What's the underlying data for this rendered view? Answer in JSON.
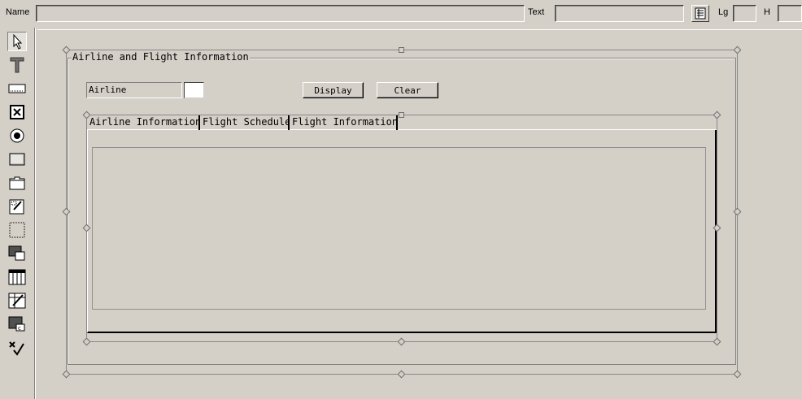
{
  "propbar": {
    "name_label": "Name",
    "name_value": "",
    "text_label": "Text",
    "text_value": "",
    "lg_label": "Lg",
    "lg_value": "",
    "h_label": "H",
    "h_value": ""
  },
  "toolbox": {
    "tools": [
      {
        "name": "pointer-icon"
      },
      {
        "name": "text-tool-icon"
      },
      {
        "name": "input-field-tool-icon"
      },
      {
        "name": "checkbox-tool-icon"
      },
      {
        "name": "radio-button-tool-icon"
      },
      {
        "name": "push-button-tool-icon"
      },
      {
        "name": "tabstrip-tool-icon"
      },
      {
        "name": "subscreen-tool-icon"
      },
      {
        "name": "box-tool-icon"
      },
      {
        "name": "custom-control-tool-icon"
      },
      {
        "name": "table-control-tool-icon"
      },
      {
        "name": "table-wizard-tool-icon"
      },
      {
        "name": "container-tool-icon"
      },
      {
        "name": "status-icon-tool-icon"
      }
    ]
  },
  "screen": {
    "group_title": "Airline and Flight Information",
    "airline_label": "Airline",
    "airline_value": "",
    "display_button": "Display",
    "clear_button": "Clear",
    "tabs": [
      {
        "label": "Airline Information"
      },
      {
        "label": "Flight Schedule"
      },
      {
        "label": "Flight Information"
      }
    ]
  },
  "colors": {
    "background": "#d4d0c8",
    "input_bg": "#ffffff"
  }
}
